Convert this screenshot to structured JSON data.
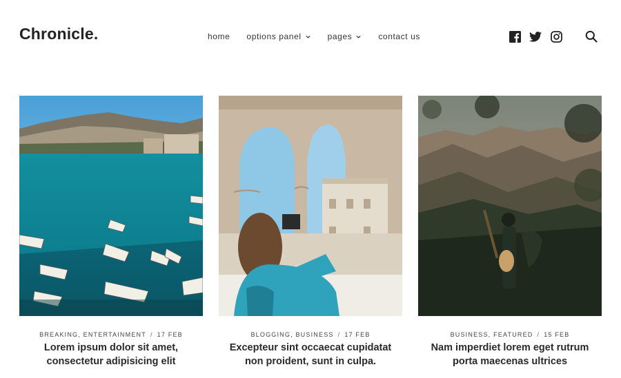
{
  "site": {
    "logo": "Chronicle."
  },
  "nav": {
    "items": [
      {
        "label": "home",
        "has_dropdown": false
      },
      {
        "label": "options panel",
        "has_dropdown": true
      },
      {
        "label": "pages",
        "has_dropdown": true
      },
      {
        "label": "contact us",
        "has_dropdown": false
      }
    ]
  },
  "social": {
    "icons": [
      "facebook-icon",
      "twitter-icon",
      "instagram-icon"
    ]
  },
  "search": {
    "icon": "search-icon"
  },
  "posts": [
    {
      "categories": "Breaking, Entertainment",
      "date": "17 Feb",
      "title": "Lorem ipsum dolor sit amet, consectetur adipisicing elit"
    },
    {
      "categories": "Blogging, Business",
      "date": "17 Feb",
      "title": "Excepteur sint occaecat cupidatat non proident, sunt in culpa."
    },
    {
      "categories": "Business, Featured",
      "date": "15 Feb",
      "title": "Nam imperdiet lorem eget rutrum porta maecenas ultrices"
    }
  ],
  "colors": {
    "text": "#222222",
    "background": "#ffffff"
  }
}
